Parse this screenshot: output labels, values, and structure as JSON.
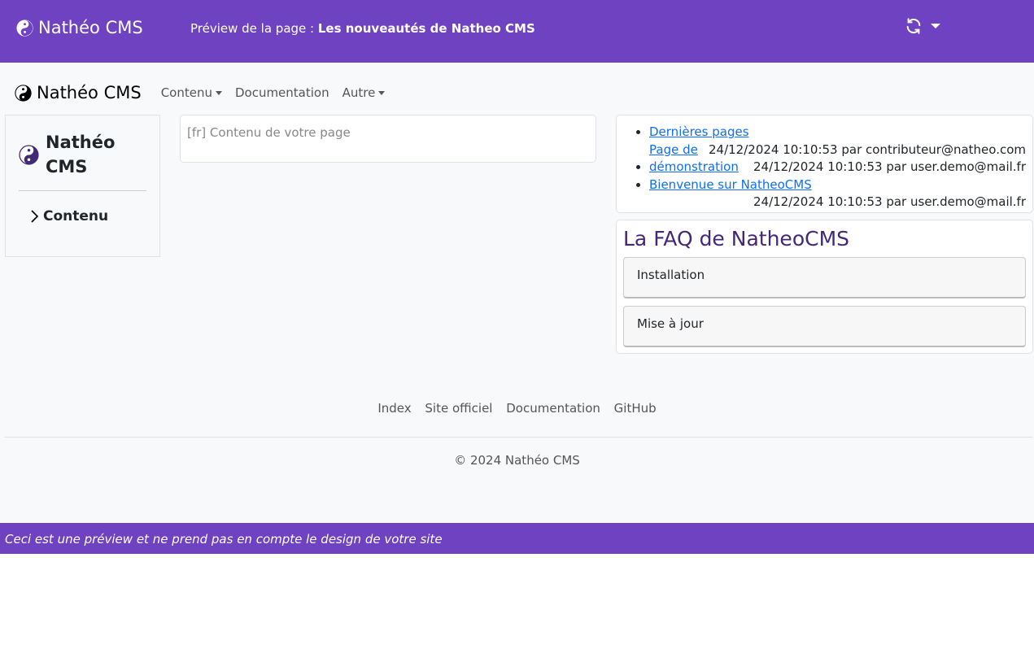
{
  "topbar": {
    "brand": "Nathéo CMS",
    "preview_label": "Préview de la page :",
    "preview_title": "Les nouveautés de Natheo CMS",
    "refresh_icon": "refresh-icon",
    "menu_icon": "caret-down-icon"
  },
  "nav": {
    "brand": "Nathéo CMS",
    "items": [
      {
        "label": "Contenu",
        "dropdown": true
      },
      {
        "label": "Documentation",
        "dropdown": false
      },
      {
        "label": "Autre",
        "dropdown": true
      }
    ]
  },
  "sidebar": {
    "title": "Nathéo CMS",
    "item": "Contenu"
  },
  "content": {
    "placeholder": "[fr] Contenu de votre page"
  },
  "recent": {
    "items": [
      {
        "link": "Dernières pages",
        "meta": ""
      },
      {
        "link": "Page de démonstration",
        "meta1": "24/12/2024 10:10:53 par contributeur@natheo.com",
        "meta2": "24/12/2024 10:10:53 par user.demo@mail.fr"
      },
      {
        "link": "Bienvenue sur NatheoCMS",
        "meta": "24/12/2024 10:10:53 par user.demo@mail.fr"
      }
    ]
  },
  "faq": {
    "title": "La FAQ de NatheoCMS",
    "items": [
      "Installation",
      "Mise à jour"
    ]
  },
  "footer": {
    "links": [
      "Index",
      "Site officiel",
      "Documentation",
      "GitHub"
    ],
    "copyright": "© 2024 Nathéo CMS"
  },
  "bottombar": {
    "text": "Ceci est une préview et ne prend pas en compte le design de votre site"
  },
  "colors": {
    "primary": "#6f42c1",
    "faq_title": "#432874",
    "link": "#0d6efd"
  }
}
